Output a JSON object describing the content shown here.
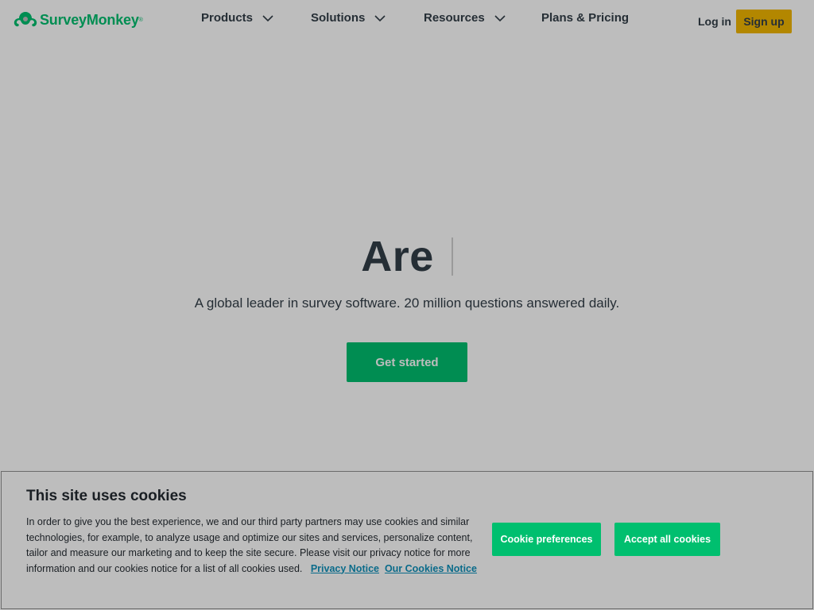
{
  "brand": {
    "name": "SurveyMonkey",
    "reg_mark": "®",
    "color": "#00bf6f"
  },
  "nav": {
    "products": "Products",
    "solutions": "Solutions",
    "resources": "Resources",
    "plans": "Plans & Pricing"
  },
  "auth": {
    "login": "Log in",
    "signup": "Sign up"
  },
  "hero": {
    "title": "Are",
    "subtitle": "A global leader in survey software. 20 million questions answered daily.",
    "cta": "Get started"
  },
  "cookie_banner": {
    "title": "This site uses cookies",
    "body": "In order to give you the best experience, we and our third party partners may use cookies and similar technologies, for example, to analyze usage and optimize our sites and services, personalize content, tailor and measure our marketing and to keep the site secure. Please visit our privacy notice for more information and our cookies notice for a list of all cookies used.",
    "privacy_link": "Privacy Notice",
    "cookies_link": "Our Cookies Notice",
    "preferences_button": "Cookie preferences",
    "accept_button": "Accept all cookies"
  },
  "colors": {
    "accent_green": "#00bf6f",
    "signup_yellow": "#f2b600",
    "link_blue": "#0a6b8a"
  },
  "icons": {
    "logo": "surveymonkey-logo-icon",
    "dropdown": "chevron-down-icon"
  }
}
